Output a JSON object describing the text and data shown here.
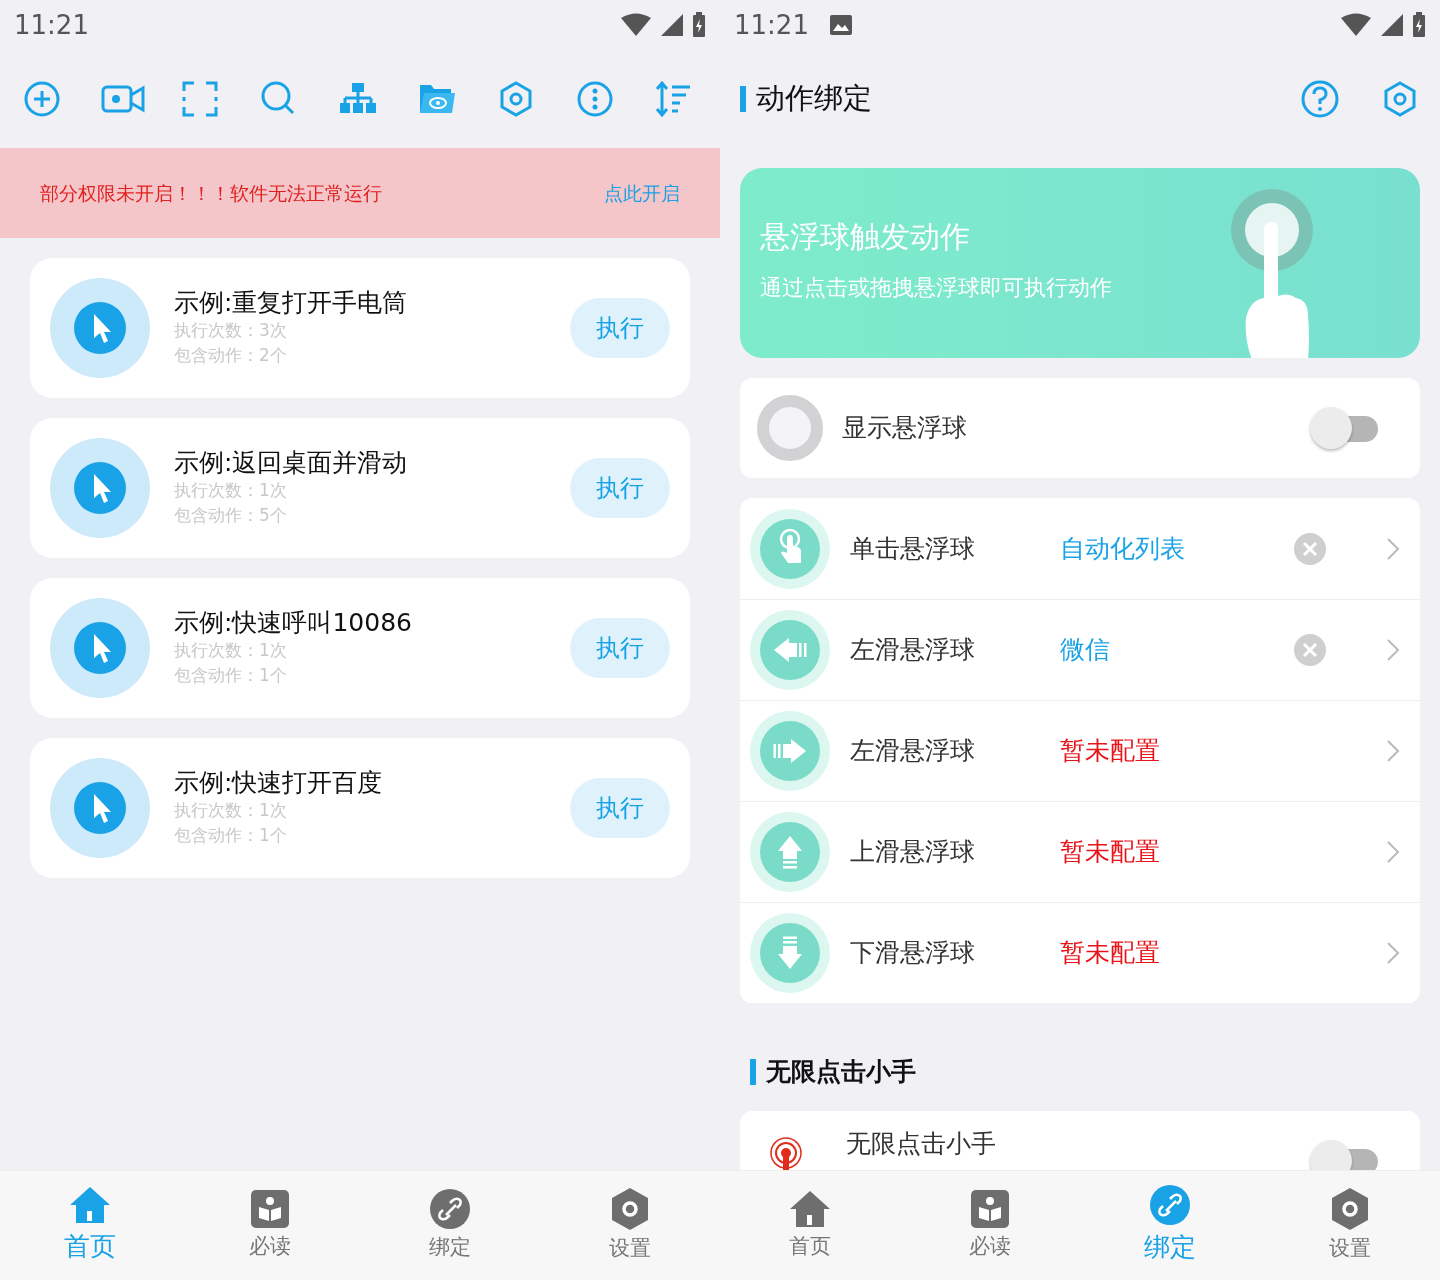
{
  "left_screen": {
    "status_bar": {
      "time": "11:21"
    },
    "warning": {
      "message": "部分权限未开启！！！软件无法正常运行",
      "action": "点此开启"
    },
    "tasks": [
      {
        "title": "示例:重复打开手电筒",
        "runs": "执行次数：3次",
        "actions": "包含动作：2个",
        "button": "执行"
      },
      {
        "title": "示例:返回桌面并滑动",
        "runs": "执行次数：1次",
        "actions": "包含动作：5个",
        "button": "执行"
      },
      {
        "title": "示例:快速呼叫10086",
        "runs": "执行次数：1次",
        "actions": "包含动作：1个",
        "button": "执行"
      },
      {
        "title": "示例:快速打开百度",
        "runs": "执行次数：1次",
        "actions": "包含动作：1个",
        "button": "执行"
      }
    ],
    "bottom_nav": [
      {
        "label": "首页",
        "kind": "home",
        "selected": true
      },
      {
        "label": "必读",
        "kind": "book",
        "selected": false
      },
      {
        "label": "绑定",
        "kind": "link",
        "selected": false
      },
      {
        "label": "设置",
        "kind": "gear",
        "selected": false
      }
    ]
  },
  "right_screen": {
    "status_bar": {
      "time": "11:21"
    },
    "header": {
      "title": "动作绑定"
    },
    "banner": {
      "title": "悬浮球触发动作",
      "subtitle": "通过点击或拖拽悬浮球即可执行动作"
    },
    "float_ball": {
      "label": "显示悬浮球",
      "on": false
    },
    "gestures": [
      {
        "kind": "tap",
        "label": "单击悬浮球",
        "target": "自动化列表",
        "configured": true
      },
      {
        "kind": "left",
        "label": "左滑悬浮球",
        "target": "微信",
        "configured": true
      },
      {
        "kind": "right",
        "label": "左滑悬浮球",
        "target": "暂未配置",
        "configured": false
      },
      {
        "kind": "up",
        "label": "上滑悬浮球",
        "target": "暂未配置",
        "configured": false
      },
      {
        "kind": "down",
        "label": "下滑悬浮球",
        "target": "暂未配置",
        "configured": false
      }
    ],
    "section_title": "无限点击小手",
    "infinite_hand": {
      "title": "无限点击小手",
      "on": false
    },
    "bottom_nav": [
      {
        "label": "首页",
        "kind": "home",
        "selected": false
      },
      {
        "label": "必读",
        "kind": "book",
        "selected": false
      },
      {
        "label": "绑定",
        "kind": "link",
        "selected": true
      },
      {
        "label": "设置",
        "kind": "gear",
        "selected": false
      }
    ]
  }
}
